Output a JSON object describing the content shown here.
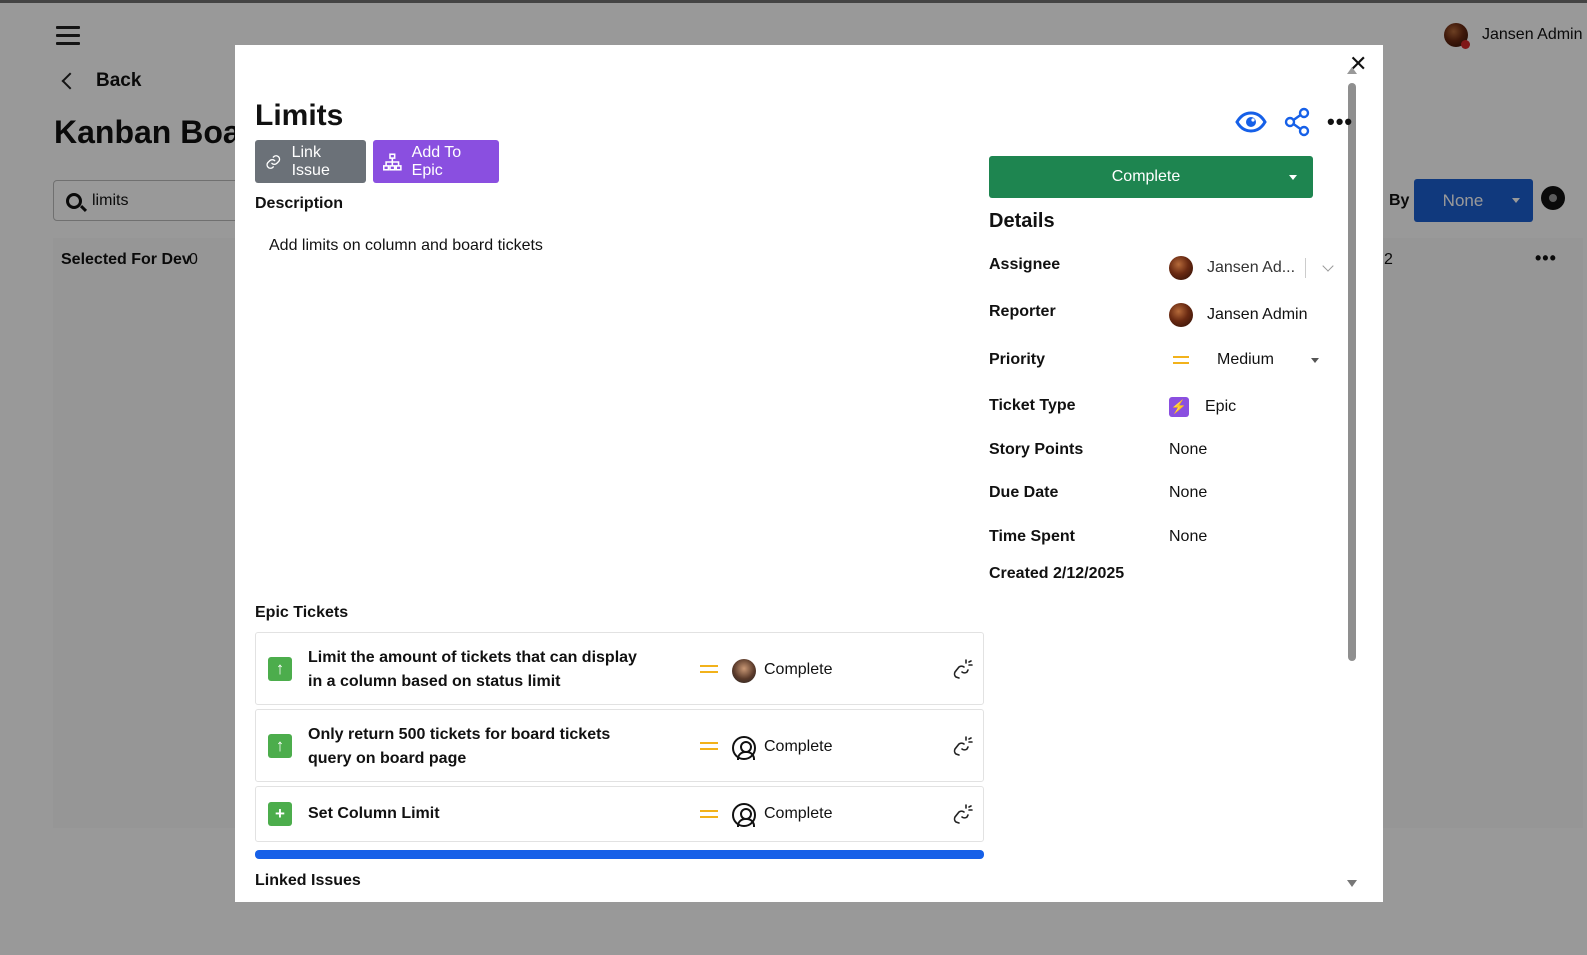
{
  "topbar": {
    "user_name": "Jansen Admin"
  },
  "nav": {
    "back_label": "Back"
  },
  "board": {
    "title": "Kanban Board",
    "search_value": "limits",
    "column_title": "Selected For Dev",
    "column_count": "0",
    "group_by_label": "By",
    "group_by_value": "None",
    "right_count": "2"
  },
  "modal": {
    "title": "Limits",
    "link_issue_label": "Link Issue",
    "add_to_epic_label": "Add To Epic",
    "description_heading": "Description",
    "description_text": "Add limits on column and board tickets",
    "status_label": "Complete",
    "details_heading": "Details",
    "details": {
      "assignee_label": "Assignee",
      "assignee_value": "Jansen Ad...",
      "reporter_label": "Reporter",
      "reporter_value": "Jansen Admin",
      "priority_label": "Priority",
      "priority_value": "Medium",
      "ticket_type_label": "Ticket Type",
      "ticket_type_value": "Epic",
      "story_points_label": "Story Points",
      "story_points_value": "None",
      "due_date_label": "Due Date",
      "due_date_value": "None",
      "time_spent_label": "Time Spent",
      "time_spent_value": "None",
      "created_text": "Created 2/12/2025"
    },
    "epic_tickets_heading": "Epic Tickets",
    "epic_tickets": [
      {
        "title_line1": "Limit the amount of tickets that can display",
        "title_line2": "in a column based on status limit",
        "status": "Complete",
        "type_icon": "story-up-arrow-icon",
        "assignee": "photo"
      },
      {
        "title_line1": "Only return 500 tickets for board tickets",
        "title_line2": "query on board page",
        "status": "Complete",
        "type_icon": "story-up-arrow-icon",
        "assignee": "unassigned"
      },
      {
        "title_line1": "Set Column Limit",
        "title_line2": "",
        "status": "Complete",
        "type_icon": "story-plus-icon",
        "assignee": "unassigned"
      }
    ],
    "epic_progress": 1.0,
    "linked_issues_heading": "Linked Issues"
  },
  "colors": {
    "status_green": "#1e8550",
    "epic_purple": "#8a4fe0",
    "link_gray": "#6b7178",
    "progress_blue": "#1660e8",
    "priority_yellow": "#f2b21b",
    "accent_blue": "#1b5fd1"
  }
}
